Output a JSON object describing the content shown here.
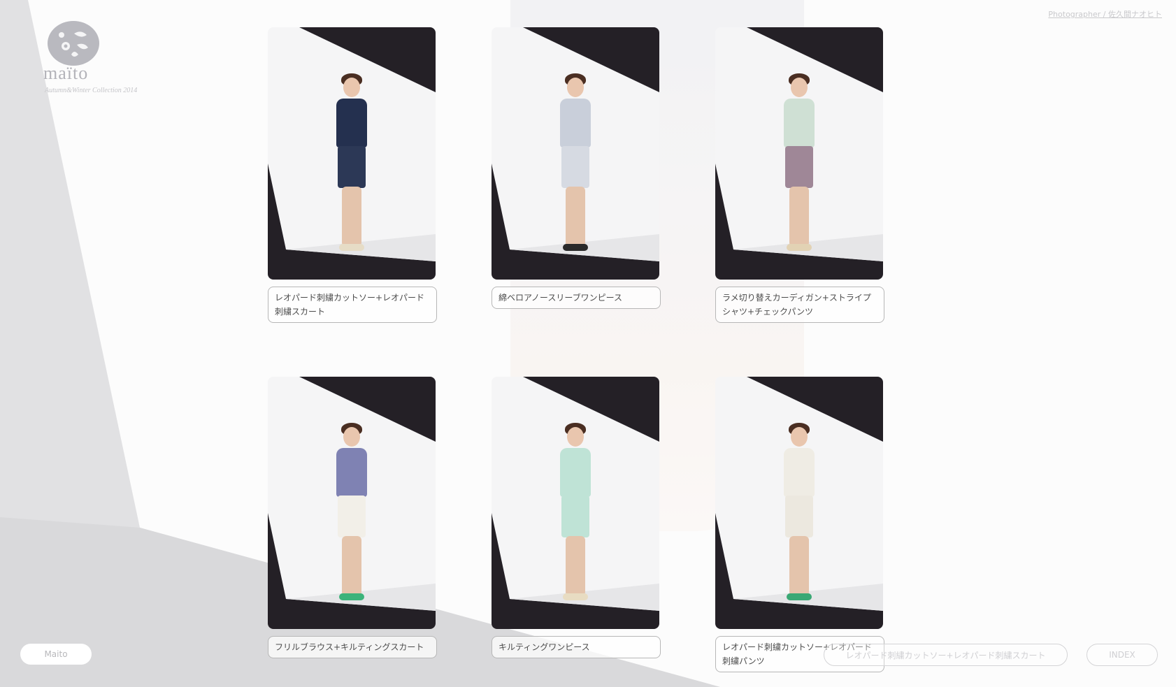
{
  "brand": {
    "name": "maïto",
    "collection": "Autumn&Winter Collection 2014"
  },
  "credit": {
    "photographer": "Photographer / 佐久間ナオヒト"
  },
  "gallery": {
    "items": [
      {
        "caption": "レオパード刺繍カットソー+レオパード刺繍スカート",
        "top_color": "#24304f",
        "bottom_color": "#2c3856",
        "shoe_color": "#e6dcc6"
      },
      {
        "caption": "綿ベロアノースリーブワンピース",
        "top_color": "#c9cfda",
        "bottom_color": "#d6dae2",
        "shoe_color": "#2a2a2a"
      },
      {
        "caption": "ラメ切り替えカーディガン+ストライプシャツ+チェックパンツ",
        "top_color": "#cfe0d4",
        "bottom_color": "#9f8797",
        "shoe_color": "#e2d2b4"
      },
      {
        "caption": "フリルブラウス+キルティングスカート",
        "top_color": "#7f82b3",
        "bottom_color": "#f2efe8",
        "shoe_color": "#3cb37a"
      },
      {
        "caption": "キルティングワンピース",
        "top_color": "#bfe3d6",
        "bottom_color": "#bfe3d6",
        "shoe_color": "#e8dcc2"
      },
      {
        "caption": "レオパード刺繍カットソー+レオパード刺繍パンツ",
        "top_color": "#efece4",
        "bottom_color": "#ece8df",
        "shoe_color": "#3aa874"
      }
    ]
  },
  "footer": {
    "maito_label": "Maito",
    "current_label": "レオパード刺繍カットソー+レオパード刺繍スカート",
    "index_label": "INDEX"
  }
}
